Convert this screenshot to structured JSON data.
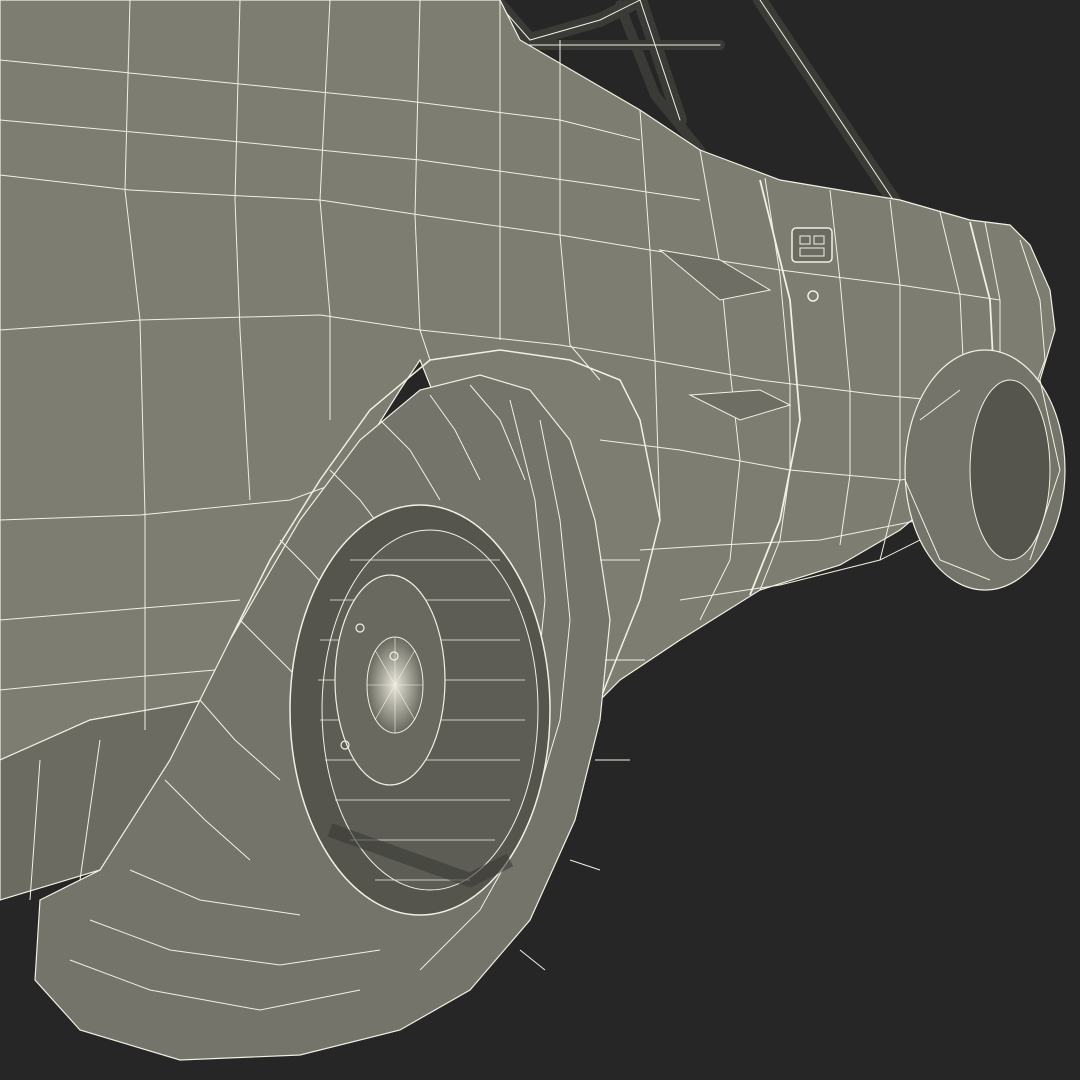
{
  "scene": {
    "subject": "",
    "colors": {
      "background": "#262626",
      "body_fill": "#7e7d72",
      "body_fill_dark": "#6c6b61",
      "tire_fill": "#75746a",
      "tire_shadow": "#3b3b37",
      "wheel_inner": "#55544d",
      "wire": "#f2f0e3",
      "cage": "#3a3a36"
    },
    "icons": [
      "wireframe-car-model"
    ]
  }
}
